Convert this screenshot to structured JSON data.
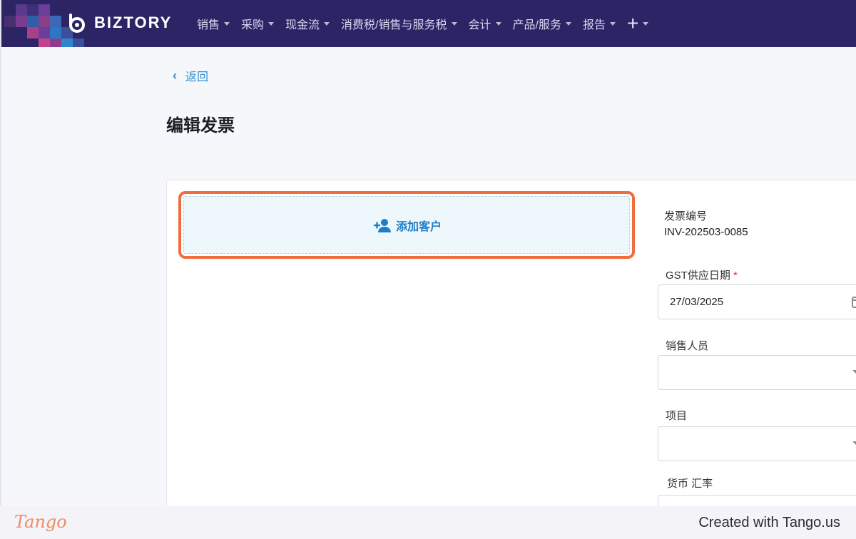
{
  "app": {
    "brand": "BIZTORY"
  },
  "nav": {
    "items": [
      {
        "label": "销售",
        "icon": "caret-down-icon"
      },
      {
        "label": "采购",
        "icon": "caret-down-icon"
      },
      {
        "label": "现金流",
        "icon": "caret-down-icon"
      },
      {
        "label": "消费税/销售与服务税",
        "icon": "caret-down-icon"
      },
      {
        "label": "会计",
        "icon": "caret-down-icon"
      },
      {
        "label": "产品/服务",
        "icon": "caret-down-icon"
      },
      {
        "label": "报告",
        "icon": "caret-down-icon"
      }
    ],
    "plus_label": "+"
  },
  "back": {
    "label": "返回"
  },
  "page": {
    "title": "编辑发票"
  },
  "customer": {
    "add_label": "添加客户"
  },
  "invoice": {
    "number_label": "发票编号",
    "number_value": "INV-202503-0085",
    "supply_date_label": "GST供应日期",
    "required_mark": "*",
    "supply_date_value": "27/03/2025",
    "salesperson_label": "销售人员",
    "salesperson_value": "",
    "project_label": "项目",
    "project_value": "",
    "currency_label": "货币 汇率"
  },
  "footer": {
    "logo": "Tango",
    "credit": "Created with Tango.us"
  },
  "colors": {
    "nav_bg": "#2b2566",
    "accent": "#2f8fd1",
    "highlight": "#f26d3d"
  }
}
